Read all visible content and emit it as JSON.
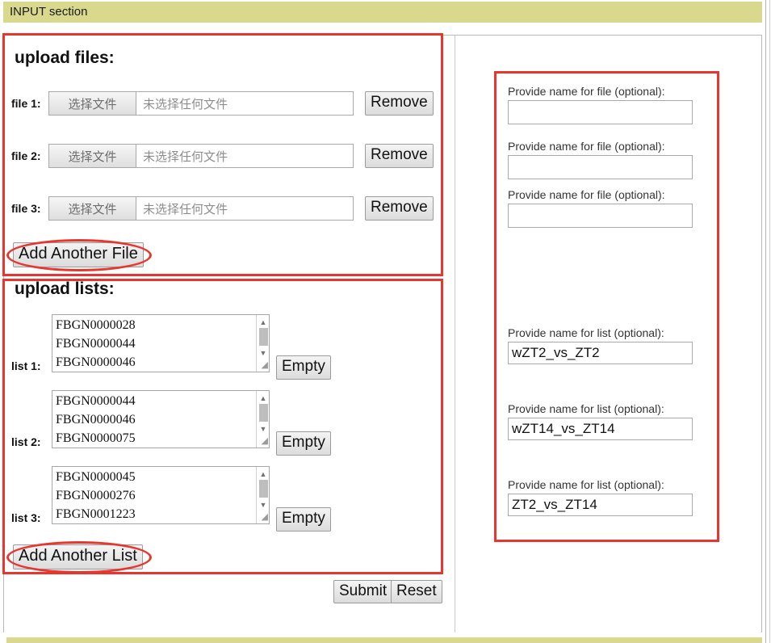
{
  "section": {
    "title": "INPUT section"
  },
  "files_block": {
    "title": "upload files:",
    "rows": [
      {
        "label": "file 1:",
        "choose_label": "选择文件",
        "placeholder": "未选择任何文件",
        "remove_label": "Remove"
      },
      {
        "label": "file 2:",
        "choose_label": "选择文件",
        "placeholder": "未选择任何文件",
        "remove_label": "Remove"
      },
      {
        "label": "file 3:",
        "choose_label": "选择文件",
        "placeholder": "未选择任何文件",
        "remove_label": "Remove"
      }
    ],
    "add_label": "Add Another File"
  },
  "lists_block": {
    "title": "upload lists:",
    "rows": [
      {
        "label": "list 1:",
        "value": "FBGN0000028\nFBGN0000044\nFBGN0000046",
        "empty_label": "Empty",
        "scroll_up_icon": "triangle-up-icon",
        "scroll_down_icon": "triangle-down-icon",
        "resize_icon": "resize-grip-icon"
      },
      {
        "label": "list 2:",
        "value": "FBGN0000044\nFBGN0000046\nFBGN0000075",
        "empty_label": "Empty",
        "scroll_up_icon": "triangle-up-icon",
        "scroll_down_icon": "triangle-down-icon",
        "resize_icon": "resize-grip-icon"
      },
      {
        "label": "list 3:",
        "value": "FBGN0000045\nFBGN0000276\nFBGN0001223",
        "empty_label": "Empty",
        "scroll_up_icon": "triangle-up-icon",
        "scroll_down_icon": "triangle-down-icon",
        "resize_icon": "resize-grip-icon"
      }
    ],
    "add_label": "Add Another List"
  },
  "actions": {
    "submit_label": "Submit",
    "reset_label": "Reset"
  },
  "right_panel": {
    "file_names": [
      {
        "label": "Provide name for file (optional):",
        "value": ""
      },
      {
        "label": "Provide name for file (optional):",
        "value": ""
      },
      {
        "label": "Provide name for file (optional):",
        "value": ""
      }
    ],
    "list_names": [
      {
        "label": "Provide name for list (optional):",
        "value": "wZT2_vs_ZT2"
      },
      {
        "label": "Provide name for list (optional):",
        "value": "wZT14_vs_ZT14"
      },
      {
        "label": "Provide name for list (optional):",
        "value": "ZT2_vs_ZT14"
      }
    ]
  },
  "colors": {
    "section_bar": "#d9d98e",
    "annotation": "#e8352e",
    "border": "#b9b9b9"
  }
}
